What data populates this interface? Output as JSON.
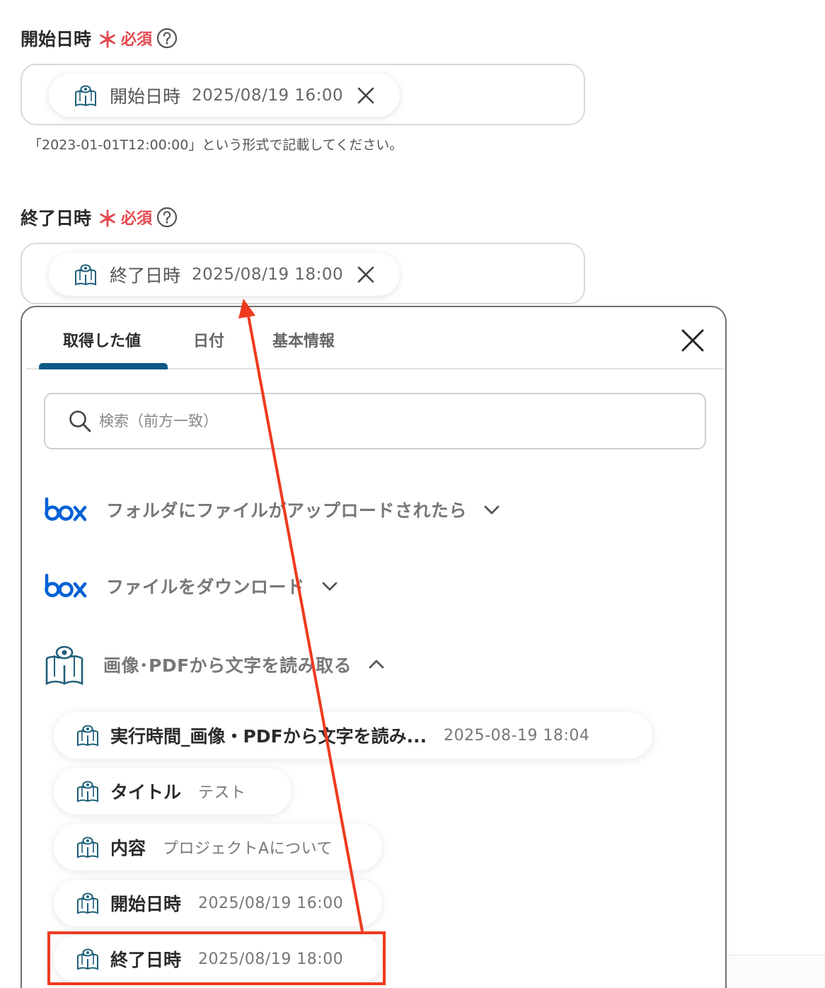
{
  "start_field": {
    "label": "開始日時",
    "required_mark": "＊",
    "required_text": "必須",
    "token_name": "開始日時",
    "token_value": "2025/08/19 16:00",
    "hint": "「2023-01-01T12:00:00」という形式で記載してください。"
  },
  "end_field": {
    "label": "終了日時",
    "required_mark": "＊",
    "required_text": "必須",
    "token_name": "終了日時",
    "token_value": "2025/08/19 18:00"
  },
  "panel": {
    "tabs": [
      "取得した値",
      "日付",
      "基本情報"
    ],
    "search_placeholder": "検索（前方一致）",
    "groups": [
      {
        "title": "フォルダにファイルがアップロードされたら",
        "icon": "box-logo",
        "state": "collapsed"
      },
      {
        "title": "ファイルをダウンロード",
        "icon": "box-logo",
        "state": "collapsed"
      },
      {
        "title": "画像･PDFから文字を読み取る",
        "icon": "ocr-book-icon",
        "state": "expanded"
      }
    ],
    "items": [
      {
        "name": "実行時間_画像・PDFから文字を読み...",
        "value": "2025-08-19 18:04"
      },
      {
        "name": "タイトル",
        "value": "テスト"
      },
      {
        "name": "内容",
        "value": "プロジェクトAについて"
      },
      {
        "name": "開始日時",
        "value": "2025/08/19 16:00"
      },
      {
        "name": "終了日時",
        "value": "2025/08/19 18:00"
      }
    ]
  },
  "colors": {
    "required": "#e5484d",
    "tab_active": "#0d5a86",
    "box_brand": "#0061d5",
    "icon_teal": "#1f5f7a",
    "annotation": "#ee3a1e"
  }
}
